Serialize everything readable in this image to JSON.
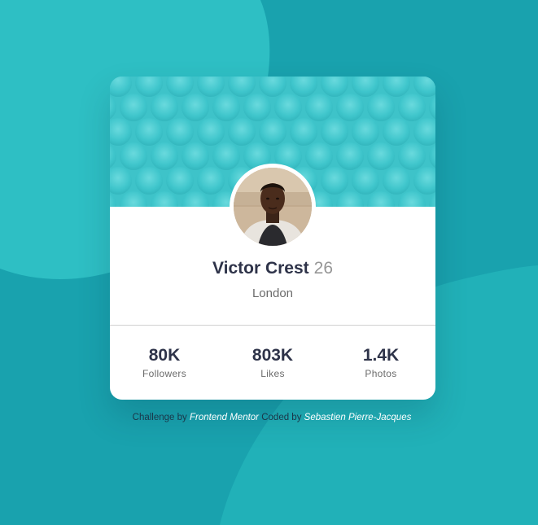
{
  "colors": {
    "page_background": "#19a2ae",
    "header_teal": "#3ec3c9",
    "text_dark": "#2e3349",
    "text_muted": "#6b6b6b",
    "attribution_link": "#ffffff"
  },
  "profile": {
    "name": "Victor Crest",
    "age": "26",
    "city": "London",
    "avatar_icon": "profile-photo"
  },
  "stats": [
    {
      "value": "80K",
      "label": "Followers"
    },
    {
      "value": "803K",
      "label": "Likes"
    },
    {
      "value": "1.4K",
      "label": "Photos"
    }
  ],
  "attribution": {
    "challenge_prefix": "Challenge by",
    "challenge_link": "Frontend Mentor",
    "coded_prefix": "Coded by",
    "coded_link": "Sebastien Pierre-Jacques"
  }
}
